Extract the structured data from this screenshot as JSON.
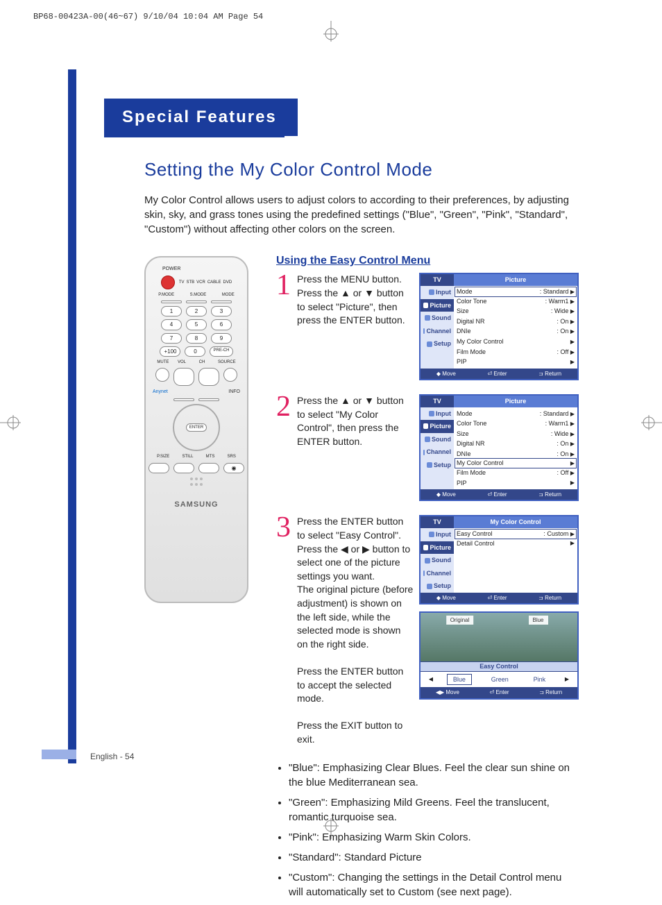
{
  "top_tag": "BP68-00423A-00(46~67)  9/10/04  10:04 AM  Page 54",
  "section_title": "Special Features",
  "page_title": "Setting the My Color Control Mode",
  "intro": "My Color Control allows users to adjust colors to according to their preferences, by adjusting skin, sky, and grass tones using the predefined settings (\"Blue\", \"Green\", \"Pink\", \"Standard\", \"Custom\") without affecting other colors on the screen.",
  "sub_header": "Using the Easy Control Menu",
  "steps": {
    "1": "Press the MENU button. Press the ▲ or ▼ button to select \"Picture\", then press the ENTER button.",
    "2": "Press the ▲ or ▼ button to select \"My Color Control\", then press the ENTER button.",
    "3a": "Press the ENTER button to select \"Easy Control\". Press the ◀ or ▶ button to select one of the picture settings you want.",
    "3b": "The original picture (before adjustment) is shown on the left side, while the selected mode is shown on the right side.",
    "3c": "Press the ENTER button to accept the selected mode.",
    "3d": "Press the EXIT button to exit."
  },
  "osd": {
    "tv_label": "TV",
    "picture_label": "Picture",
    "mycolor_label": "My Color Control",
    "side_items": [
      "Input",
      "Picture",
      "Sound",
      "Channel",
      "Setup"
    ],
    "menu1": [
      {
        "k": "Mode",
        "v": ": Standard"
      },
      {
        "k": "Color Tone",
        "v": ": Warm1"
      },
      {
        "k": "Size",
        "v": ": Wide"
      },
      {
        "k": "Digital NR",
        "v": ": On"
      },
      {
        "k": "DNIe",
        "v": ": On"
      },
      {
        "k": "My Color Control",
        "v": ""
      },
      {
        "k": "Film Mode",
        "v": ": Off"
      },
      {
        "k": "PIP",
        "v": ""
      }
    ],
    "menu3": [
      {
        "k": "Easy Control",
        "v": ": Custom"
      },
      {
        "k": "Detail Control",
        "v": ""
      }
    ],
    "foot_move": "Move",
    "foot_enter": "Enter",
    "foot_return": "Return"
  },
  "easy": {
    "original": "Original",
    "mode": "Blue",
    "bar": "Easy Control",
    "opts": [
      "Blue",
      "Green",
      "Pink"
    ],
    "foot_move": "Move",
    "foot_enter": "Enter",
    "foot_return": "Return"
  },
  "bullets": [
    "\"Blue\": Emphasizing Clear Blues. Feel the clear sun shine on the blue Mediterranean sea.",
    "\"Green\": Emphasizing Mild Greens. Feel the translucent, romantic turquoise sea.",
    "\"Pink\": Emphasizing Warm Skin Colors.",
    "\"Standard\": Standard Picture",
    "\"Custom\": Changing the settings in the Detail Control menu will automatically set to Custom (see next page)."
  ],
  "remote": {
    "brand": "SAMSUNG",
    "top_labels": [
      "TV",
      "STB",
      "VCR",
      "CABLE",
      "DVD"
    ],
    "power": "POWER",
    "row_labels": [
      "P.MODE",
      "S.MODE",
      "MODE"
    ],
    "nums": [
      [
        "1",
        "2",
        "3"
      ],
      [
        "4",
        "5",
        "6"
      ],
      [
        "7",
        "8",
        "9"
      ],
      [
        "+100",
        "0",
        "PRE-CH"
      ]
    ],
    "mid_labels": [
      "MUTE",
      "CH",
      "SOURCE",
      "VOL"
    ],
    "anynet": "Anynet",
    "info": "INFO",
    "enter": "ENTER",
    "bottom_labels": [
      "P.SIZE",
      "STILL",
      "MTS",
      "SRS"
    ]
  },
  "footer": "English - 54"
}
